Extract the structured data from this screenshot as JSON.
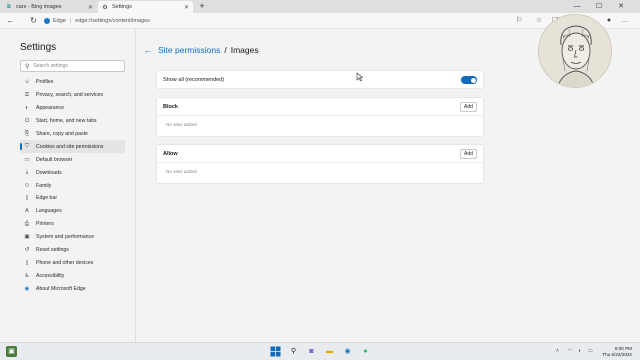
{
  "browser": {
    "tabs": [
      {
        "title": "cars - Bing images",
        "active": false,
        "icon": "bing-icon"
      },
      {
        "title": "Settings",
        "active": true,
        "icon": "gear-icon"
      }
    ],
    "new_tab_label": "+",
    "address": {
      "prefix": "Edge",
      "url": "edge://settings/content/images"
    },
    "window_controls": {
      "minimize": "—",
      "maximize": "☐",
      "close": "✕"
    }
  },
  "sidebar": {
    "title": "Settings",
    "search_placeholder": "Search settings",
    "items": [
      {
        "label": "Profiles",
        "icon": "person-icon"
      },
      {
        "label": "Privacy, search, and services",
        "icon": "lock-icon"
      },
      {
        "label": "Appearance",
        "icon": "palette-icon"
      },
      {
        "label": "Start, home, and new tabs",
        "icon": "power-icon"
      },
      {
        "label": "Share, copy and paste",
        "icon": "share-icon"
      },
      {
        "label": "Cookies and site permissions",
        "icon": "shield-icon",
        "selected": true
      },
      {
        "label": "Default browser",
        "icon": "browser-icon"
      },
      {
        "label": "Downloads",
        "icon": "download-icon"
      },
      {
        "label": "Family",
        "icon": "family-icon"
      },
      {
        "label": "Edge bar",
        "icon": "edgebar-icon"
      },
      {
        "label": "Languages",
        "icon": "language-icon"
      },
      {
        "label": "Printers",
        "icon": "printer-icon"
      },
      {
        "label": "System and performance",
        "icon": "system-icon"
      },
      {
        "label": "Reset settings",
        "icon": "reset-icon"
      },
      {
        "label": "Phone and other devices",
        "icon": "phone-icon"
      },
      {
        "label": "Accessibility",
        "icon": "accessibility-icon"
      },
      {
        "label": "About Microsoft Edge",
        "icon": "edge-logo-icon"
      }
    ]
  },
  "main": {
    "breadcrumb": {
      "parent": "Site permissions",
      "separator": "/",
      "current": "Images"
    },
    "show_all": {
      "label": "Show all (recommended)",
      "enabled": true
    },
    "block": {
      "title": "Block",
      "add_label": "Add",
      "empty_text": "No sites added"
    },
    "allow": {
      "title": "Allow",
      "add_label": "Add",
      "empty_text": "No sites added"
    }
  },
  "taskbar": {
    "time": "9:00 PM",
    "date": "Thu 6/23/2022"
  },
  "colors": {
    "accent": "#0f6cbd",
    "taskbar": "#e9ecef"
  }
}
